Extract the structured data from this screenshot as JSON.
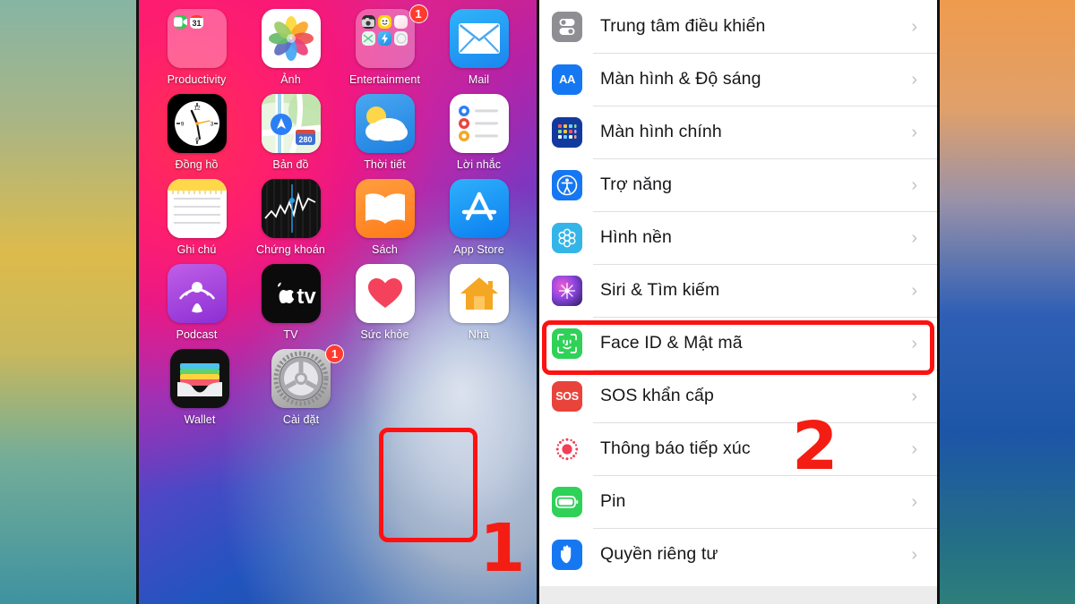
{
  "annotations": {
    "step1": "1",
    "step2": "2",
    "highlight_color": "#ff1111",
    "number_color": "#f41d14"
  },
  "home_screen": {
    "rows": [
      [
        {
          "label": "Productivity",
          "icon": "folder-productivity-icon",
          "badge": null
        },
        {
          "label": "Ảnh",
          "icon": "photos-icon",
          "badge": null
        },
        {
          "label": "Entertainment",
          "icon": "folder-entertainment-icon",
          "badge": "1"
        },
        {
          "label": "Mail",
          "icon": "mail-icon",
          "badge": null
        }
      ],
      [
        {
          "label": "Đồng hồ",
          "icon": "clock-icon",
          "badge": null
        },
        {
          "label": "Bản đồ",
          "icon": "maps-icon",
          "badge": null
        },
        {
          "label": "Thời tiết",
          "icon": "weather-icon",
          "badge": null
        },
        {
          "label": "Lời nhắc",
          "icon": "reminders-icon",
          "badge": null
        }
      ],
      [
        {
          "label": "Ghi chú",
          "icon": "notes-icon",
          "badge": null
        },
        {
          "label": "Chứng khoán",
          "icon": "stocks-icon",
          "badge": null
        },
        {
          "label": "Sách",
          "icon": "books-icon",
          "badge": null
        },
        {
          "label": "App Store",
          "icon": "appstore-icon",
          "badge": null
        }
      ],
      [
        {
          "label": "Podcast",
          "icon": "podcast-icon",
          "badge": null
        },
        {
          "label": "TV",
          "icon": "tv-icon",
          "badge": null
        },
        {
          "label": "Sức khỏe",
          "icon": "health-icon",
          "badge": null
        },
        {
          "label": "Nhà",
          "icon": "home-icon",
          "badge": null
        }
      ],
      [
        {
          "label": "Wallet",
          "icon": "wallet-icon",
          "badge": null
        },
        {
          "label": "Cài đặt",
          "icon": "settings-gear-icon",
          "badge": "1"
        }
      ]
    ],
    "maps_shield_label": "280",
    "calendar_day": "31"
  },
  "settings": {
    "items": [
      {
        "label": "Trung tâm điều khiển",
        "icon": "control-center-icon",
        "highlighted": false
      },
      {
        "label": "Màn hình & Độ sáng",
        "icon": "display-brightness-icon",
        "highlighted": false
      },
      {
        "label": "Màn hình chính",
        "icon": "home-screen-icon",
        "highlighted": false
      },
      {
        "label": "Trợ năng",
        "icon": "accessibility-icon",
        "highlighted": false
      },
      {
        "label": "Hình nền",
        "icon": "wallpaper-icon",
        "highlighted": false
      },
      {
        "label": "Siri & Tìm kiếm",
        "icon": "siri-search-icon",
        "highlighted": false
      },
      {
        "label": "Face ID & Mật mã",
        "icon": "face-id-icon",
        "highlighted": true
      },
      {
        "label": "SOS khẩn cấp",
        "icon": "sos-icon",
        "highlighted": false
      },
      {
        "label": "Thông báo tiếp xúc",
        "icon": "exposure-notification-icon",
        "highlighted": false
      },
      {
        "label": "Pin",
        "icon": "battery-icon",
        "highlighted": false
      },
      {
        "label": "Quyền riêng tư",
        "icon": "privacy-hand-icon",
        "highlighted": false
      }
    ],
    "chevron": "›",
    "display_icon_text": "AA",
    "sos_icon_text": "SOS"
  }
}
